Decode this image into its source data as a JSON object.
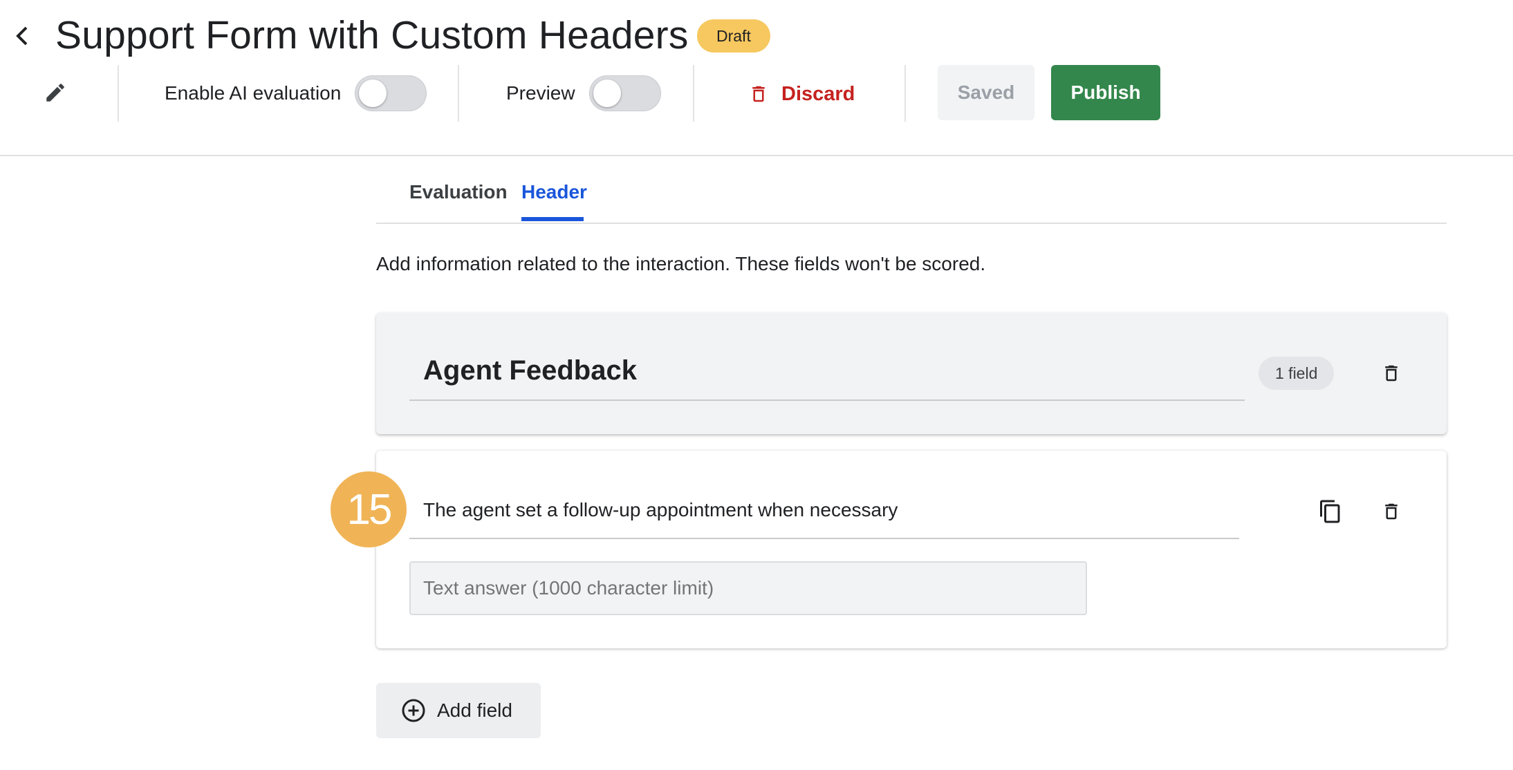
{
  "header": {
    "title": "Support Form with Custom Headers",
    "status_badge": "Draft"
  },
  "toolbar": {
    "ai_evaluation_label": "Enable AI evaluation",
    "ai_evaluation_on": false,
    "preview_label": "Preview",
    "preview_on": false,
    "discard_label": "Discard",
    "saved_label": "Saved",
    "publish_label": "Publish"
  },
  "tabs": [
    {
      "label": "Evaluation",
      "active": false
    },
    {
      "label": "Header",
      "active": true
    }
  ],
  "description": "Add information related to the interaction. These fields won't be scored.",
  "section": {
    "title": "Agent Feedback",
    "field_count": "1 field"
  },
  "field": {
    "number": "15",
    "question": "The agent set a follow-up appointment when necessary",
    "answer_placeholder": "Text answer (1000 character limit)"
  },
  "add_field_label": "Add field",
  "colors": {
    "publish": "#34874c",
    "discard": "#c5221f",
    "active_tab": "#1a56db",
    "draft_badge": "#f6c85f",
    "number_badge": "#f0b457"
  },
  "icons": [
    "chevron-left-icon",
    "pencil-icon",
    "trash-icon",
    "copy-icon",
    "plus-circle-icon"
  ]
}
